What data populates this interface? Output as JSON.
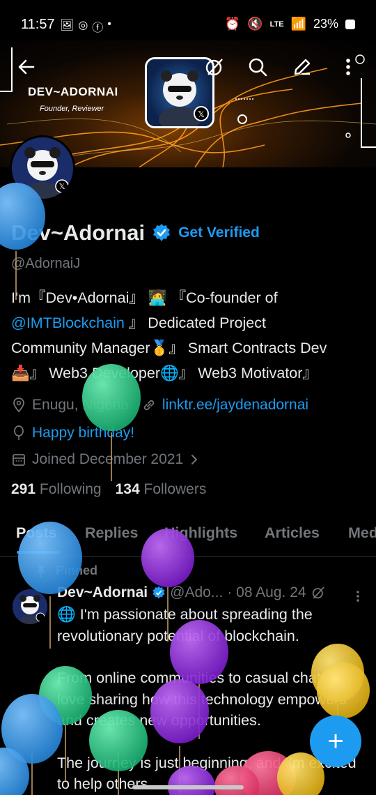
{
  "status_bar": {
    "time": "11:57",
    "network": "LTE",
    "battery": "23%"
  },
  "banner": {
    "name": "DEV~ADORNAI",
    "role": "Founder, Reviewer"
  },
  "profile": {
    "display_name": "Dev~Adornai",
    "get_verified": "Get Verified",
    "handle": "@AdornaiJ",
    "bio_line1_pre": "I'm『Dev•Adornai』",
    "bio_line1_emoji": "🧑‍💻",
    "bio_line1_post": "『Co-founder of",
    "bio_mention": "@IMTBlockchain",
    "bio_line2_post": "』 Dedicated Project",
    "bio_line3": "Community Manager🥇』 Smart Contracts Dev",
    "bio_line4": "📥』 Web3 Developer🌐』 Web3 Motivator』",
    "location": "Enugu, Nigeria",
    "website": "linktr.ee/jaydenadornai",
    "birthday": "Happy birthday!",
    "joined": "Joined December 2021",
    "following_count": "291",
    "following_label": "Following",
    "followers_count": "134",
    "followers_label": "Followers"
  },
  "tabs": [
    {
      "label": "Posts"
    },
    {
      "label": "Replies"
    },
    {
      "label": "Highlights"
    },
    {
      "label": "Articles"
    },
    {
      "label": "Media"
    }
  ],
  "post": {
    "pinned_label": "Pinned",
    "author": "Dev~Adornai",
    "handle": "@Ado...",
    "date": "· 08 Aug. 24",
    "paragraph1": "🌐 I'm passionate about spreading the revolutionary potential of blockchain.",
    "paragraph2": "From online communities to casual chats, I love sharing how this technology empowers and creates new opportunities.",
    "paragraph3": "The journey is just beginning, and I'm excited to help others"
  },
  "fab": {
    "icon": "plus-icon",
    "label": "+"
  },
  "colors": {
    "accent": "#1d9bf0",
    "text": "#e7e9ea",
    "muted": "#71767b",
    "background": "#000000"
  }
}
